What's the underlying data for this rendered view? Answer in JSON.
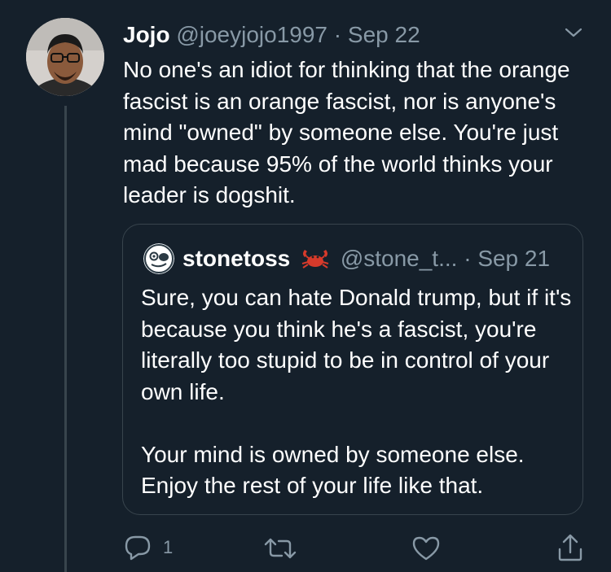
{
  "tweet": {
    "author_name": "Jojo",
    "handle": "@joeyjojo1997",
    "separator": "·",
    "date": "Sep 22",
    "text": "No one's an idiot for thinking that the orange fascist is an orange fascist, nor is anyone's mind \"owned\" by someone else. You're just mad because 95% of the world thinks your leader is dogshit.",
    "menu_icon": "chevron-down-icon"
  },
  "quoted_tweet": {
    "author_name": "stonetoss",
    "name_emoji_icon": "crab-icon",
    "handle": "@stone_t...",
    "separator": "·",
    "date": "Sep 21",
    "text": "Sure, you can hate Donald trump, but if it's because you think he's a fascist, you're literally too stupid to be in control of your own life.\n\nYour mind is owned by someone else. Enjoy the rest of your life like that."
  },
  "actions": {
    "reply_count": "1",
    "icons": [
      "reply-icon",
      "retweet-icon",
      "like-icon",
      "share-icon"
    ]
  },
  "colors": {
    "background": "#15202b",
    "text": "#ffffff",
    "secondary": "#8899a6",
    "border": "#38444d"
  }
}
